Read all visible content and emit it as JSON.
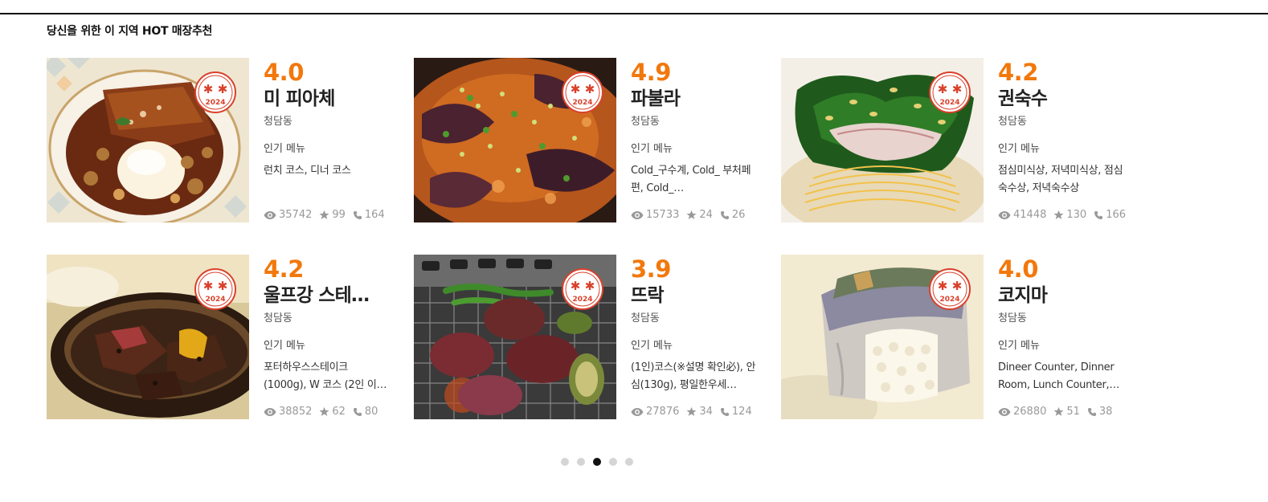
{
  "section": {
    "title": "당신을 위한 이 지역 HOT 매장추천"
  },
  "badge_text": "2024",
  "menu_label": "인기 메뉴",
  "colors": {
    "accent": "#f2780c",
    "badge_red": "#d9412b",
    "stat_gray": "#999999",
    "dot_active": "#111111",
    "dot_inactive": "#d5d5d5"
  },
  "icons": {
    "views": "eye-icon",
    "rating": "star-icon",
    "calls": "phone-icon",
    "badge": "ribbon-2024-badge-icon"
  },
  "restaurants": [
    {
      "rating": "4.0",
      "name": "미 피아체",
      "area": "청담동",
      "menu": "런치 코스, 디너 코스",
      "views": "35742",
      "stars": "99",
      "calls": "164"
    },
    {
      "rating": "4.9",
      "name": "파불라",
      "area": "청담동",
      "menu": "Cold_구수계, Cold_ 부처페편, Cold_…",
      "views": "15733",
      "stars": "24",
      "calls": "26"
    },
    {
      "rating": "4.2",
      "name": "권숙수",
      "area": "청담동",
      "menu": "점심미식상, 저녁미식상, 점심숙수상, 저녁숙수상",
      "views": "41448",
      "stars": "130",
      "calls": "166"
    },
    {
      "rating": "4.2",
      "name": "울프강 스테…",
      "area": "청담동",
      "menu": "포터하우스스테이크 (1000g), W 코스 (2인 이…",
      "views": "38852",
      "stars": "62",
      "calls": "80"
    },
    {
      "rating": "3.9",
      "name": "뜨락",
      "area": "청담동",
      "menu": "(1인)코스(※설명 확인必), 안심(130g), 평일한우세…",
      "views": "27876",
      "stars": "34",
      "calls": "124"
    },
    {
      "rating": "4.0",
      "name": "코지마",
      "area": "청담동",
      "menu": "Dineer Counter, Dinner Room, Lunch Counter,…",
      "views": "26880",
      "stars": "51",
      "calls": "38"
    }
  ],
  "pagination": {
    "total": 5,
    "active_index": 2
  }
}
